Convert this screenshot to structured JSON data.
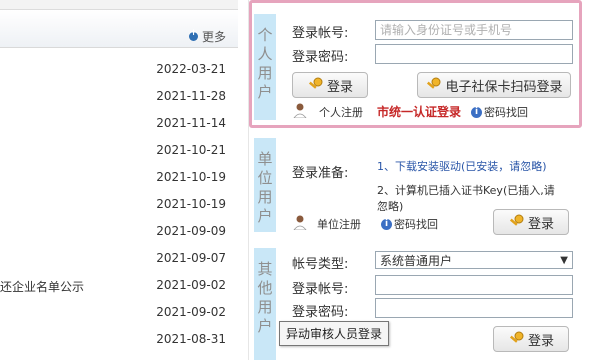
{
  "news": {
    "more_label": "更多",
    "dates": [
      "2022-03-21",
      "2021-11-28",
      "2021-11-14",
      "2021-10-21",
      "2021-10-19",
      "2021-10-19",
      "2021-09-09",
      "2021-09-07",
      "2021-09-02",
      "2021-09-02",
      "2021-08-31"
    ],
    "partial_title_row8": "还企业名单公示"
  },
  "personal": {
    "tab_chars": [
      "个",
      "人",
      "用",
      "户"
    ],
    "account_label": "登录帐号:",
    "account_placeholder": "请输入身份证号或手机号",
    "password_label": "登录密码:",
    "login_button": "登录",
    "scan_button": "电子社保卡扫码登录",
    "register_link": "个人注册",
    "unified_link": "市统一认证登录",
    "recover_link": "密码找回"
  },
  "unit": {
    "tab_chars": [
      "单",
      "位",
      "用",
      "户"
    ],
    "prep_label": "登录准备:",
    "step1": "1、下载安装驱动(已安装，请忽略)",
    "step2_line1": "2、计算机已插入证书Key(已插入,请",
    "step2_line2": "忽略)",
    "register_link": "单位注册",
    "recover_link": "密码找回",
    "login_button": "登录"
  },
  "other": {
    "tab_chars": [
      "其",
      "他",
      "用",
      "户"
    ],
    "type_label": "帐号类型:",
    "type_value": "系统普通用户",
    "account_label": "登录帐号:",
    "password_label": "登录密码:",
    "tooltip": "异动审核人员登录",
    "login_button": "登录"
  },
  "colors": {
    "tab_bg": "#c9e7f7",
    "highlight_border": "#e6a4bd",
    "link_blue": "#2a56a8",
    "link_red": "#c62828"
  }
}
